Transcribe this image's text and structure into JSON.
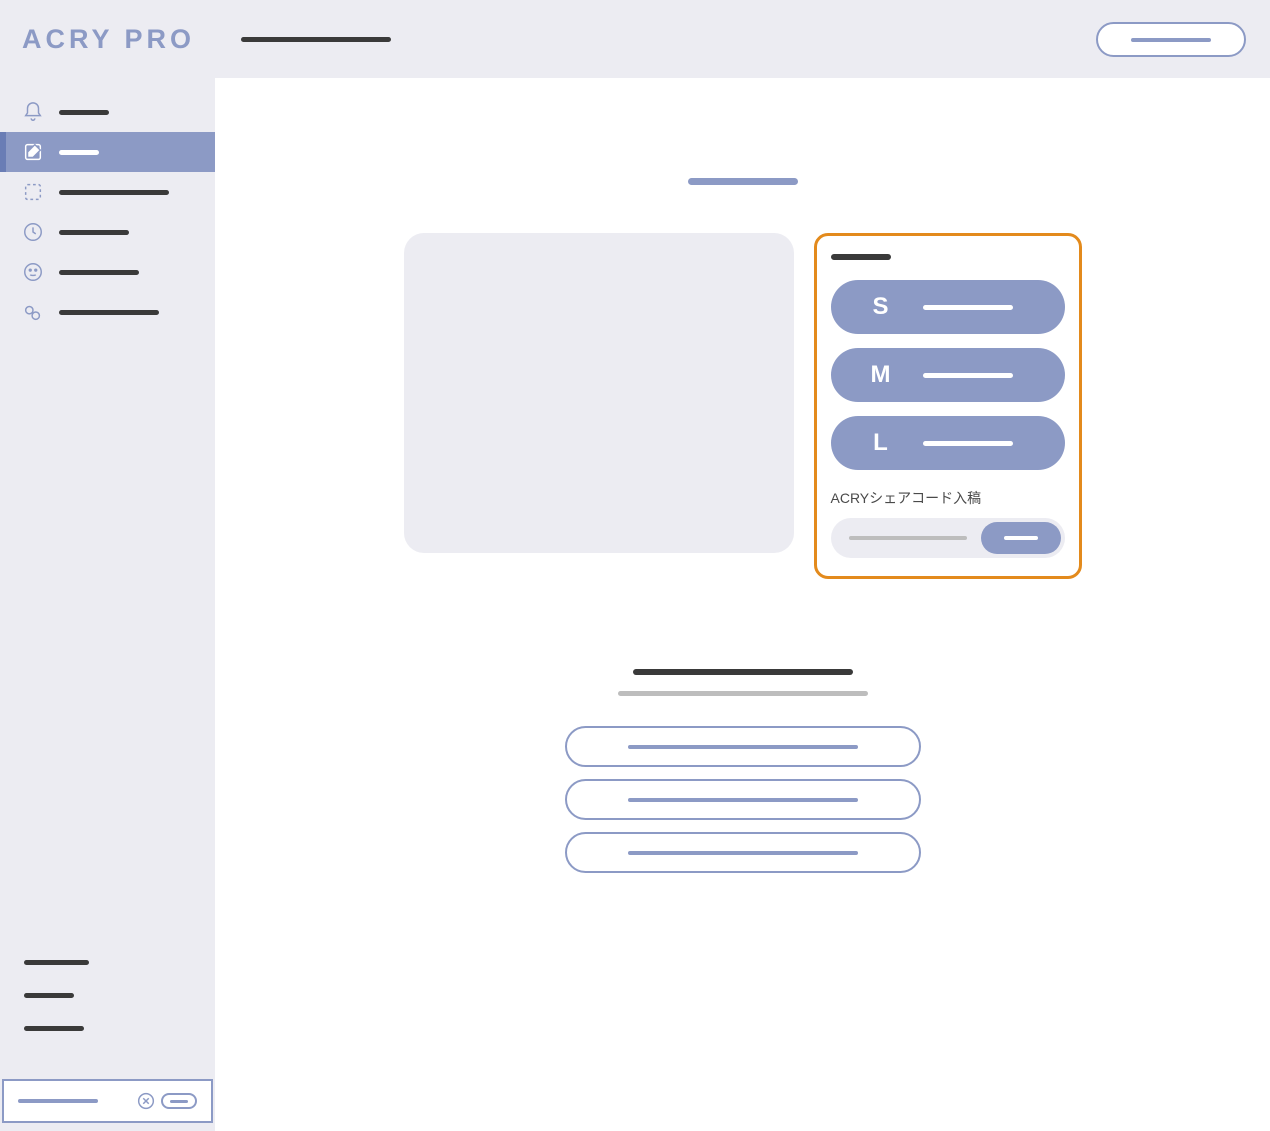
{
  "logo": "ACRY PRO",
  "sidebar": {
    "items": [
      {
        "label_w": 50
      },
      {
        "label_w": 40
      },
      {
        "label_w": 110
      },
      {
        "label_w": 70
      },
      {
        "label_w": 80
      },
      {
        "label_w": 100
      }
    ]
  },
  "size_panel": {
    "share_label": "ACRYシェアコード入稿",
    "sizes": [
      {
        "letter": "S"
      },
      {
        "letter": "M"
      },
      {
        "letter": "L"
      }
    ]
  }
}
